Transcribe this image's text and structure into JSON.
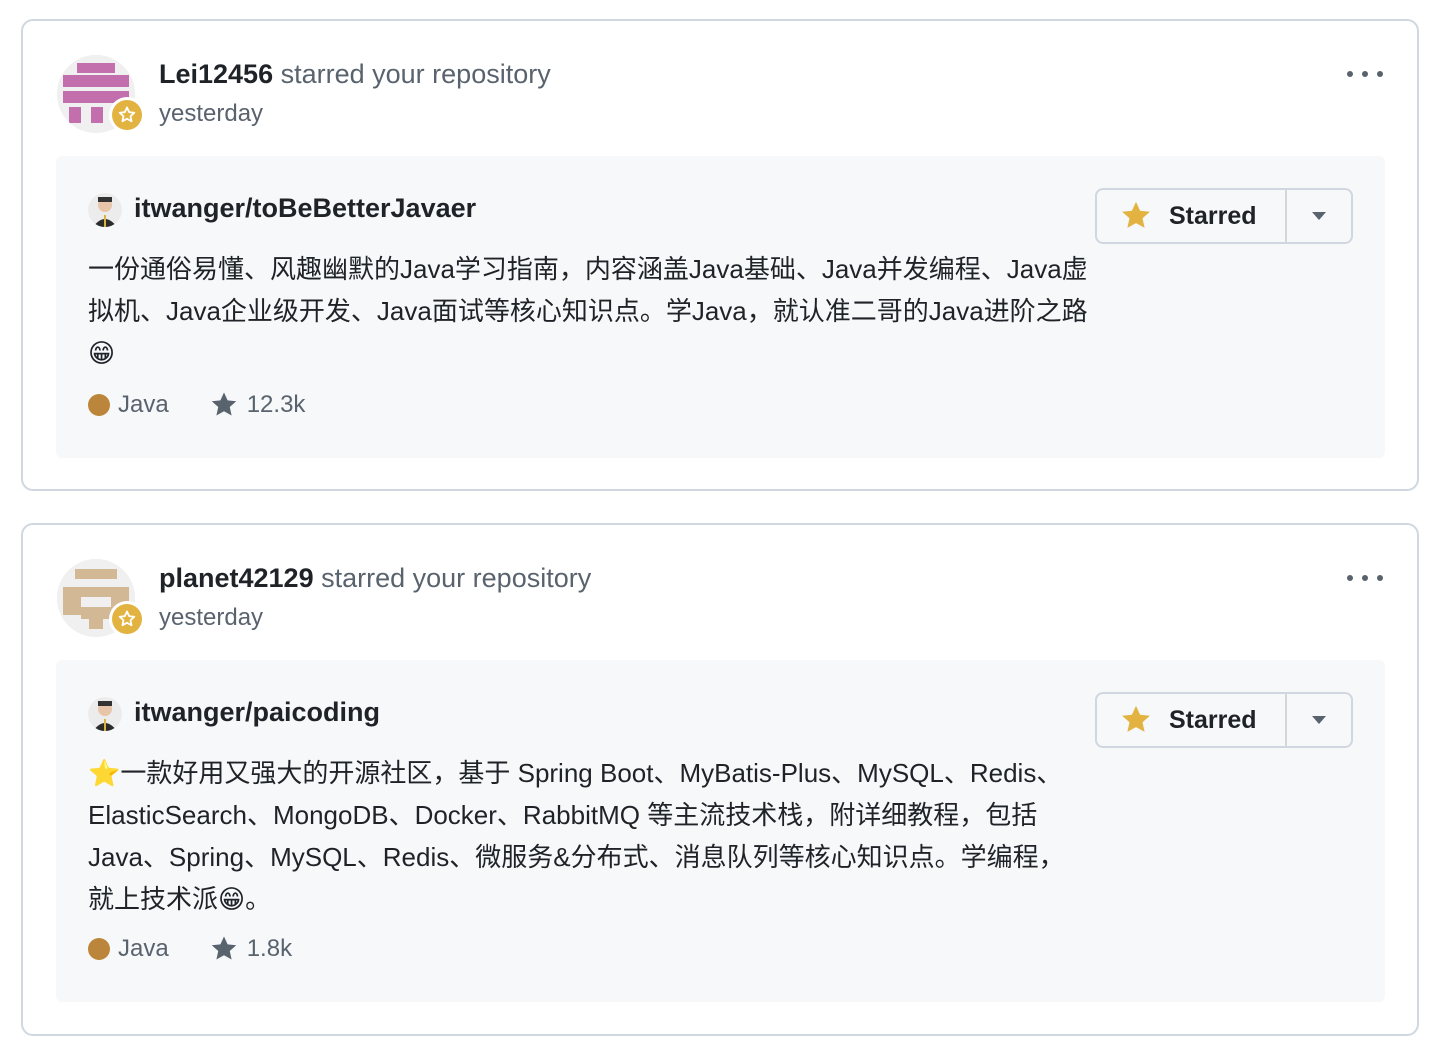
{
  "notifications": [
    {
      "user": "Lei12456",
      "action": "starred your repository",
      "time": "yesterday",
      "avatar_color": "#c46fad",
      "repo": {
        "full_name": "itwanger/toBeBetterJavaer",
        "description": "一份通俗易懂、风趣幽默的Java学习指南，内容涵盖Java基础、Java并发编程、Java虚拟机、Java企业级开发、Java面试等核心知识点。学Java，就认准二哥的Java进阶之路😁",
        "language": "Java",
        "language_color": "#b07219",
        "stars": "12.3k",
        "star_button_label": "Starred"
      }
    },
    {
      "user": "planet42129",
      "action": "starred your repository",
      "time": "yesterday",
      "avatar_color": "#d3b896",
      "repo": {
        "full_name": "itwanger/paicoding",
        "description": "⭐一款好用又强大的开源社区，基于 Spring Boot、MyBatis-Plus、MySQL、Redis、ElasticSearch、MongoDB、Docker、RabbitMQ 等主流技术栈，附详细教程，包括Java、Spring、MySQL、Redis、微服务&分布式、消息队列等核心知识点。学编程，就上技术派😁。",
        "language": "Java",
        "language_color": "#b07219",
        "stars": "1.8k",
        "star_button_label": "Starred"
      }
    }
  ],
  "icons": {
    "more": "kebab-horizontal-icon",
    "badge": "star-badge-icon",
    "star_button": "star-fill-icon",
    "stars_meta": "star-icon",
    "dropdown": "triangle-down-icon"
  },
  "colors": {
    "star_yellow": "#e3b341",
    "muted_text": "#59636e",
    "border": "#d0d7de",
    "repo_bg": "#f6f8fa"
  }
}
